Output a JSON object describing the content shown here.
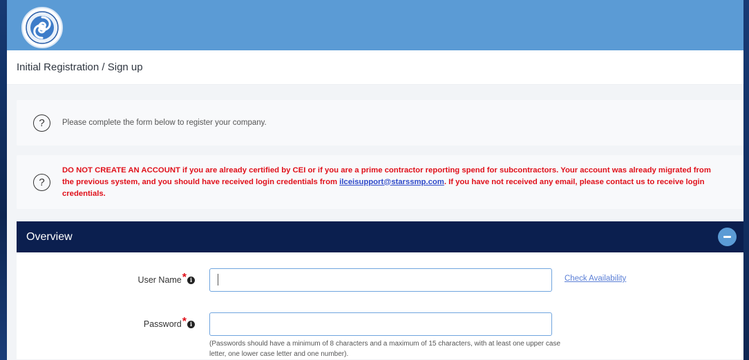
{
  "header": {
    "logo_icon": "state-seal-swirl-icon",
    "colors": {
      "topbar": "#5b9bd5",
      "panel_header": "#0b1f4f",
      "warning": "#e0101a"
    }
  },
  "breadcrumb": {
    "title": "Initial Registration / Sign up"
  },
  "notices": {
    "info_text": "Please complete the form below to register your company.",
    "warning": {
      "lead": "DO NOT CREATE AN ACCOUNT if you are already certified by CEI or if you are a prime contractor reporting spend for subcontractors. Your account was already migrated from the previous system, and you should have received login credentials from ",
      "email": "ilceisupport@starssmp.com",
      "tail": ". If you have not received any email, please contact us to receive login credentials."
    },
    "icon": "?"
  },
  "overview": {
    "title": "Overview",
    "collapse_icon": "minus-circle-icon",
    "fields": {
      "username_label": "User Name ",
      "username_value": "",
      "check_availability": "Check Availability",
      "password_label": "Password",
      "password_value": "",
      "password_hint": "(Passwords should have a minimum of 8 characters and a maximum of 15 characters, with at least one upper case letter, one lower case letter and one number)."
    },
    "required_mark": "*",
    "info_mark": "i"
  }
}
